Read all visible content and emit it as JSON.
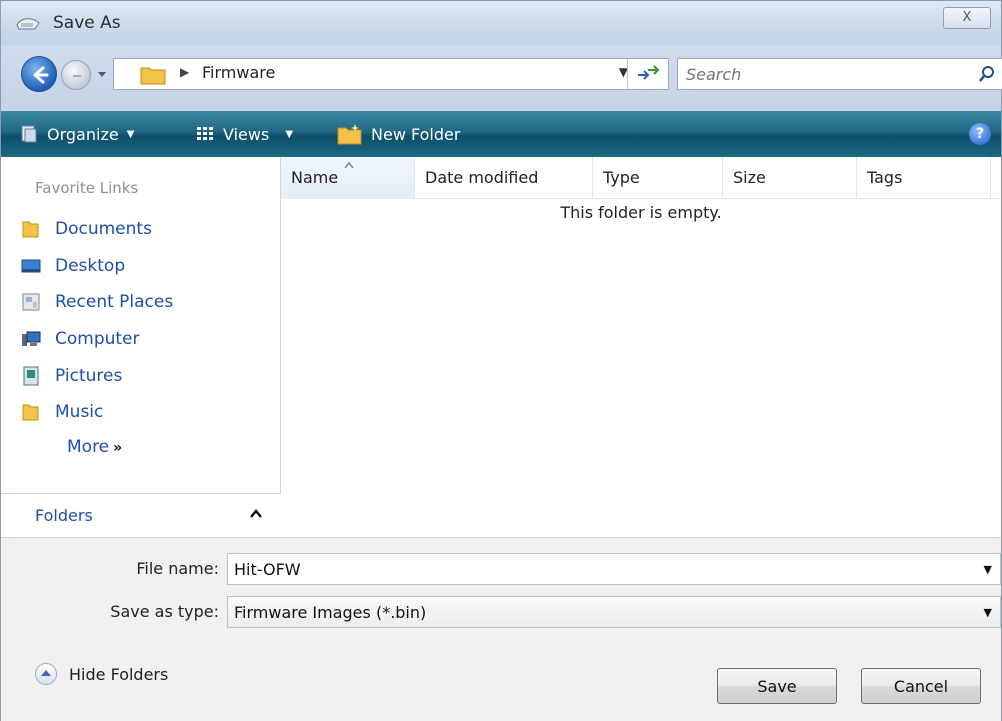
{
  "window": {
    "title": "Save As",
    "close_label": "X"
  },
  "address": {
    "current_folder": "Firmware",
    "search_placeholder": "Search"
  },
  "toolbar": {
    "organize": "Organize",
    "views": "Views",
    "new_folder": "New Folder",
    "help": "?"
  },
  "navpane": {
    "heading": "Favorite Links",
    "items": [
      {
        "label": "Documents",
        "icon": "folder-icon"
      },
      {
        "label": "Desktop",
        "icon": "desktop-icon"
      },
      {
        "label": "Recent Places",
        "icon": "recent-places-icon"
      },
      {
        "label": "Computer",
        "icon": "computer-icon"
      },
      {
        "label": "Pictures",
        "icon": "pictures-icon"
      },
      {
        "label": "Music",
        "icon": "music-folder-icon"
      }
    ],
    "more": "More",
    "folders": "Folders"
  },
  "filelist": {
    "columns": [
      "Name",
      "Date modified",
      "Type",
      "Size",
      "Tags"
    ],
    "empty_message": "This folder is empty."
  },
  "form": {
    "filename_label": "File name:",
    "filename_value": "Hit-OFW",
    "savetype_label": "Save as type:",
    "savetype_value": "Firmware Images (*.bin)"
  },
  "footer": {
    "hide_folders": "Hide Folders",
    "save": "Save",
    "cancel": "Cancel"
  },
  "colors": {
    "toolbar": "#1e6682",
    "link": "#1f4ea8",
    "titlebar": "#cfdcec"
  }
}
